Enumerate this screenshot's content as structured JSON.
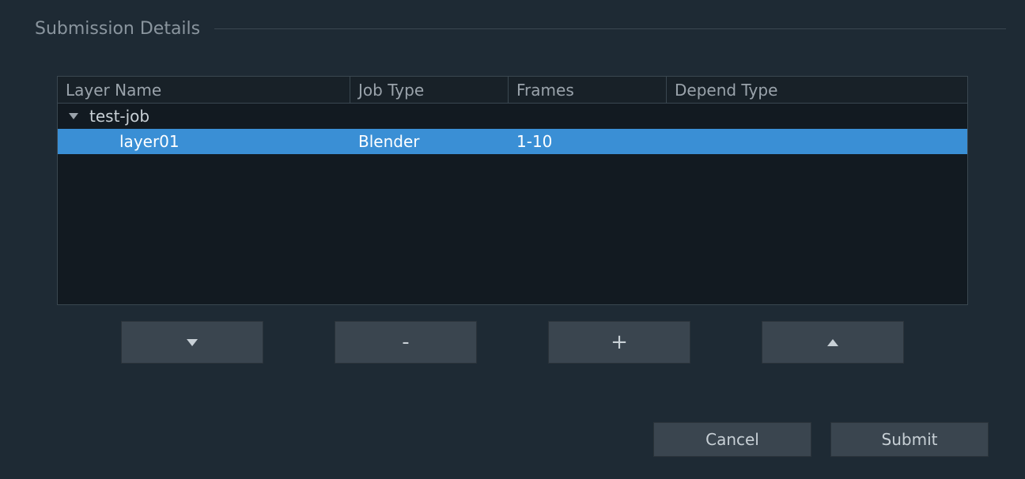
{
  "section": {
    "title": "Submission Details"
  },
  "table": {
    "headers": {
      "layer_name": "Layer Name",
      "job_type": "Job Type",
      "frames": "Frames",
      "depend": "Depend Type"
    },
    "rows": [
      {
        "name": "test-job",
        "job_type": "",
        "frames": "",
        "depend": "",
        "expanded": true,
        "level": 0,
        "selected": false
      },
      {
        "name": "layer01",
        "job_type": "Blender",
        "frames": "1-10",
        "depend": "",
        "level": 1,
        "selected": true
      }
    ]
  },
  "toolbar": {
    "move_down_icon": "triangle-down",
    "remove_label": "-",
    "add_label": "+",
    "move_up_icon": "triangle-up"
  },
  "dialog": {
    "cancel_label": "Cancel",
    "submit_label": "Submit"
  }
}
